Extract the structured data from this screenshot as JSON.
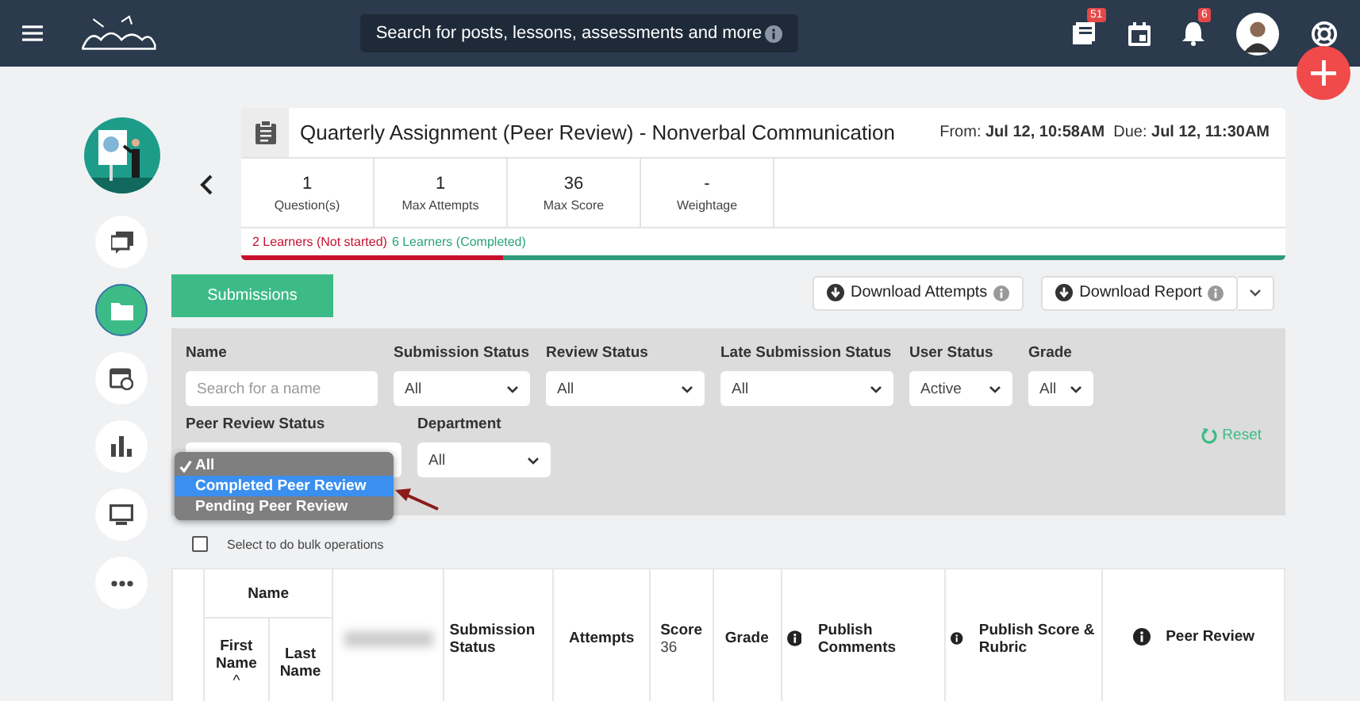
{
  "header": {
    "search_placeholder": "Search for posts, lessons, assessments and more",
    "posts_badge": "51",
    "notifications_badge": "6"
  },
  "sidebar": {
    "items": [
      {
        "kind": "chat",
        "selected": false
      },
      {
        "kind": "folder",
        "selected": true
      },
      {
        "kind": "calendar",
        "selected": false
      },
      {
        "kind": "chart",
        "selected": false
      },
      {
        "kind": "screen",
        "selected": false
      },
      {
        "kind": "more",
        "selected": false
      }
    ]
  },
  "assignment": {
    "title": "Quarterly Assignment (Peer Review) - Nonverbal Communication",
    "from_label": "From:",
    "from": "Jul 12, 10:58AM",
    "due_label": "Due:",
    "due": "Jul 12, 11:30AM",
    "stats": [
      {
        "value": "1",
        "label": "Question(s)"
      },
      {
        "value": "1",
        "label": "Max Attempts"
      },
      {
        "value": "36",
        "label": "Max Score"
      },
      {
        "value": "-",
        "label": "Weightage"
      }
    ],
    "not_started": "2 Learners (Not started)",
    "completed": "6 Learners (Completed)",
    "level": 0.25
  },
  "tabs": [
    {
      "label": "Submissions",
      "selected": true
    }
  ],
  "buttons": [
    {
      "label": "Download Attempts",
      "split": false
    },
    {
      "label": "Download Report",
      "split": true
    }
  ],
  "filters": [
    [
      {
        "label": "Name",
        "kind": "text",
        "placeholder": "Search for a name"
      },
      {
        "label": "Submission Status",
        "kind": "select",
        "value": "All"
      },
      {
        "label": "Review Status",
        "kind": "select",
        "value": "All"
      },
      {
        "label": "Late Submission Status",
        "kind": "select",
        "value": "All"
      },
      {
        "label": "User Status",
        "kind": "select",
        "value": "Active"
      },
      {
        "label": "Grade",
        "kind": "select",
        "value": "All"
      }
    ],
    [
      {
        "label": "Peer Review Status",
        "kind": "select"
      },
      {
        "label": "Department",
        "kind": "select",
        "value": "All"
      }
    ]
  ],
  "dropdown": [
    {
      "label": "All",
      "selected": true,
      "highlighted": false
    },
    {
      "label": "Completed Peer Review",
      "selected": false,
      "highlighted": true
    },
    {
      "label": "Pending Peer Review",
      "selected": false,
      "highlighted": false
    }
  ],
  "reset": "Reset",
  "bulk": {
    "label": "Select to do bulk operations",
    "checked": false
  },
  "table": {
    "group": "Name",
    "first_name": "First Name",
    "last_name": "Last Name",
    "sort_mark": "^",
    "columns": [
      {
        "label": "Submission Status",
        "info": false
      },
      {
        "label": "Attempts",
        "info": false
      },
      {
        "label": "Score",
        "info": false,
        "sub": "36"
      },
      {
        "label": "Grade",
        "info": false
      },
      {
        "label": "Publish Comments",
        "info": true
      },
      {
        "label": "Publish Score & Rubric",
        "info": true
      },
      {
        "label": "Peer Review",
        "info": true
      }
    ]
  }
}
